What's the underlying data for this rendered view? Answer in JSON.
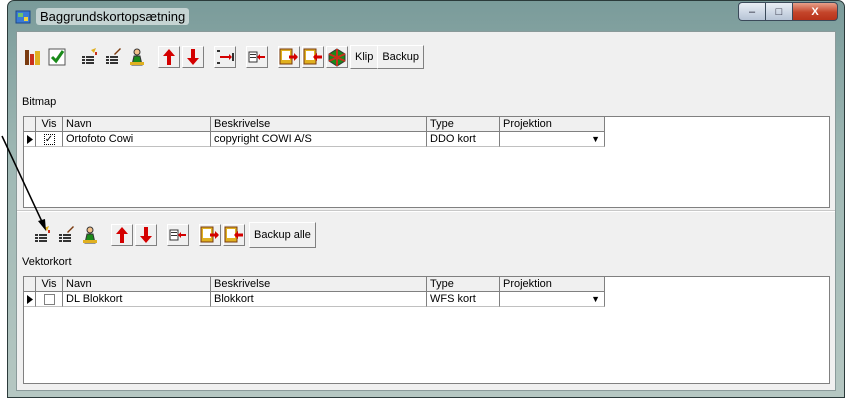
{
  "window": {
    "title": "Baggrundskortopsætning",
    "min": "–",
    "max": "□",
    "close": "X"
  },
  "bitmap": {
    "section_label": "Bitmap",
    "klip_label": "Klip",
    "backup_label": "Backup",
    "columns": [
      "Vis",
      "Navn",
      "Beskrivelse",
      "Type",
      "Projektion"
    ],
    "rows": [
      {
        "vis": "✓",
        "navn": "Ortofoto Cowi",
        "beskrivelse": "copyright COWI A/S",
        "type": "DDO kort",
        "projektion": ""
      }
    ]
  },
  "vektor": {
    "section_label": "Vektorkort",
    "backup_all_label": "Backup alle",
    "columns": [
      "Vis",
      "Navn",
      "Beskrivelse",
      "Type",
      "Projektion"
    ],
    "rows": [
      {
        "vis": "",
        "navn": "DL Blokkort",
        "beskrivelse": "Blokkort",
        "type": "WFS kort",
        "projektion": ""
      }
    ]
  },
  "icons": [
    "app-icon",
    "tool-icon",
    "check-icon",
    "edit-icon",
    "edit-icon",
    "person-icon",
    "arrow-up-icon",
    "arrow-down-icon",
    "move-icon",
    "insert-icon",
    "export-icon",
    "import-icon",
    "map-icon",
    "row-pointer-icon",
    "dropdown-arrow-icon"
  ],
  "colors": {
    "arrow_red": "#d40000",
    "accent_green": "#1a8a1a"
  }
}
